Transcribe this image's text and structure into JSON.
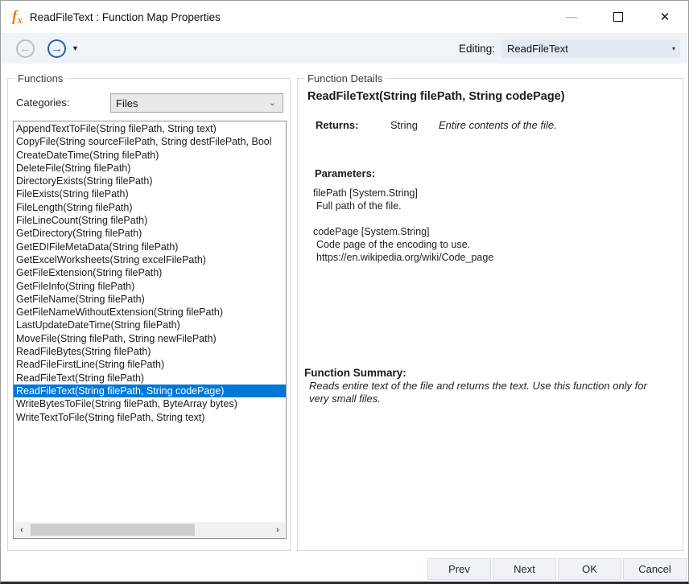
{
  "window": {
    "title": "ReadFileText : Function Map Properties",
    "icon_f": "f",
    "icon_x": "x",
    "minimize_glyph": "—",
    "close_glyph": "✕"
  },
  "toolbar": {
    "back_glyph": "←",
    "forward_glyph": "→",
    "dropdown_caret": "▼",
    "editing_label": "Editing:",
    "editing_value": "ReadFileText"
  },
  "functions_panel": {
    "title": "Functions",
    "categories_label": "Categories:",
    "categories_value": "Files",
    "combo_caret": "⌄",
    "scroll_left": "‹",
    "scroll_right": "›",
    "selected_index": 20,
    "items": [
      "AppendTextToFile(String filePath, String text)",
      "CopyFile(String sourceFilePath, String destFilePath, Bool",
      "CreateDateTime(String filePath)",
      "DeleteFile(String filePath)",
      "DirectoryExists(String filePath)",
      "FileExists(String filePath)",
      "FileLength(String filePath)",
      "FileLineCount(String filePath)",
      "GetDirectory(String filePath)",
      "GetEDIFileMetaData(String filePath)",
      "GetExcelWorksheets(String excelFilePath)",
      "GetFileExtension(String filePath)",
      "GetFileInfo(String filePath)",
      "GetFileName(String filePath)",
      "GetFileNameWithoutExtension(String filePath)",
      "LastUpdateDateTime(String filePath)",
      "MoveFile(String filePath, String newFilePath)",
      "ReadFileBytes(String filePath)",
      "ReadFileFirstLine(String filePath)",
      "ReadFileText(String filePath)",
      "ReadFileText(String filePath, String codePage)",
      "WriteBytesToFile(String filePath, ByteArray bytes)",
      "WriteTextToFile(String filePath, String text)"
    ]
  },
  "details_panel": {
    "title": "Function Details",
    "signature": "ReadFileText(String filePath, String codePage)",
    "returns_label": "Returns:",
    "returns_type": "String",
    "returns_desc": "Entire contents of the file.",
    "parameters_label": "Parameters:",
    "parameters": [
      {
        "name": "filePath [System.String]",
        "desc": "Full path of the file.",
        "link": ""
      },
      {
        "name": "codePage [System.String]",
        "desc": "Code page of the encoding to use.",
        "link": "https://en.wikipedia.org/wiki/Code_page"
      }
    ],
    "summary_label": "Function Summary:",
    "summary_text": "Reads entire text of the file and returns the text. Use this function only for very small files."
  },
  "footer": {
    "buttons": [
      "Prev",
      "Next",
      "OK",
      "Cancel"
    ]
  },
  "colors": {
    "selection_blue": "#0078d7",
    "icon_orange": "#e0821f",
    "toolbar_bg": "#eff4f9"
  }
}
